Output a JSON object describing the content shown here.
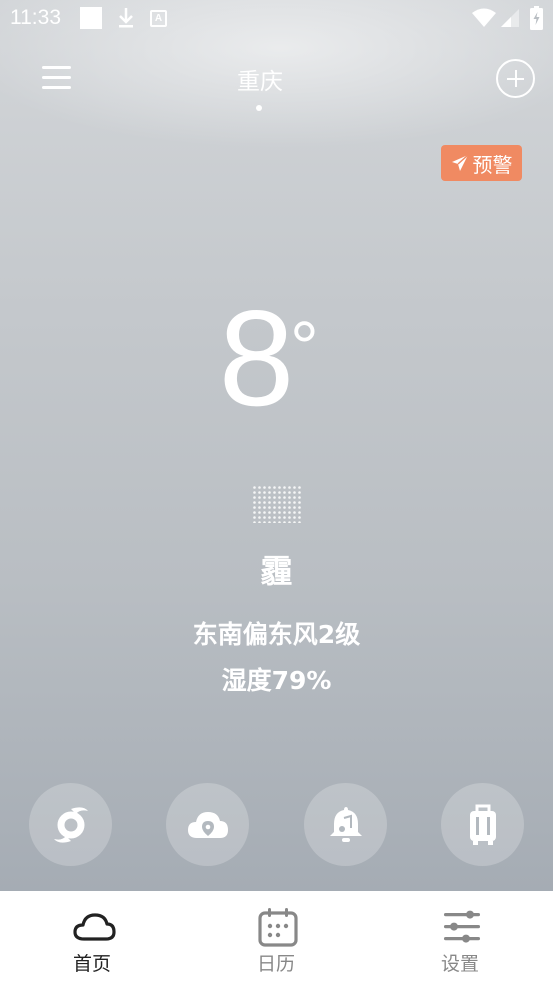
{
  "status_bar": {
    "time": "11:33",
    "icons": [
      "notification-square-icon",
      "download-icon",
      "a-icon",
      "wifi-icon",
      "signal-icon",
      "battery-icon"
    ]
  },
  "header": {
    "menu_icon": "menu-icon",
    "city": "重庆",
    "add_icon": "add-circle-icon"
  },
  "alert": {
    "label": "预警",
    "icon": "send-icon",
    "color": "#f08a62"
  },
  "current": {
    "temperature": "8",
    "unit": "°",
    "condition_icon": "haze-dots-icon",
    "condition": "霾",
    "wind": "东南偏东风2级",
    "humidity": "湿度79%"
  },
  "quick_actions": [
    {
      "icon": "typhoon-icon"
    },
    {
      "icon": "cloud-location-icon"
    },
    {
      "icon": "bell-music-icon"
    },
    {
      "icon": "luggage-icon"
    }
  ],
  "bottom_nav": {
    "items": [
      {
        "label": "首页",
        "icon": "cloud-icon",
        "active": true
      },
      {
        "label": "日历",
        "icon": "calendar-icon",
        "active": false
      },
      {
        "label": "设置",
        "icon": "settings-sliders-icon",
        "active": false
      }
    ],
    "active_color": "#222222",
    "inactive_color": "#888888"
  }
}
